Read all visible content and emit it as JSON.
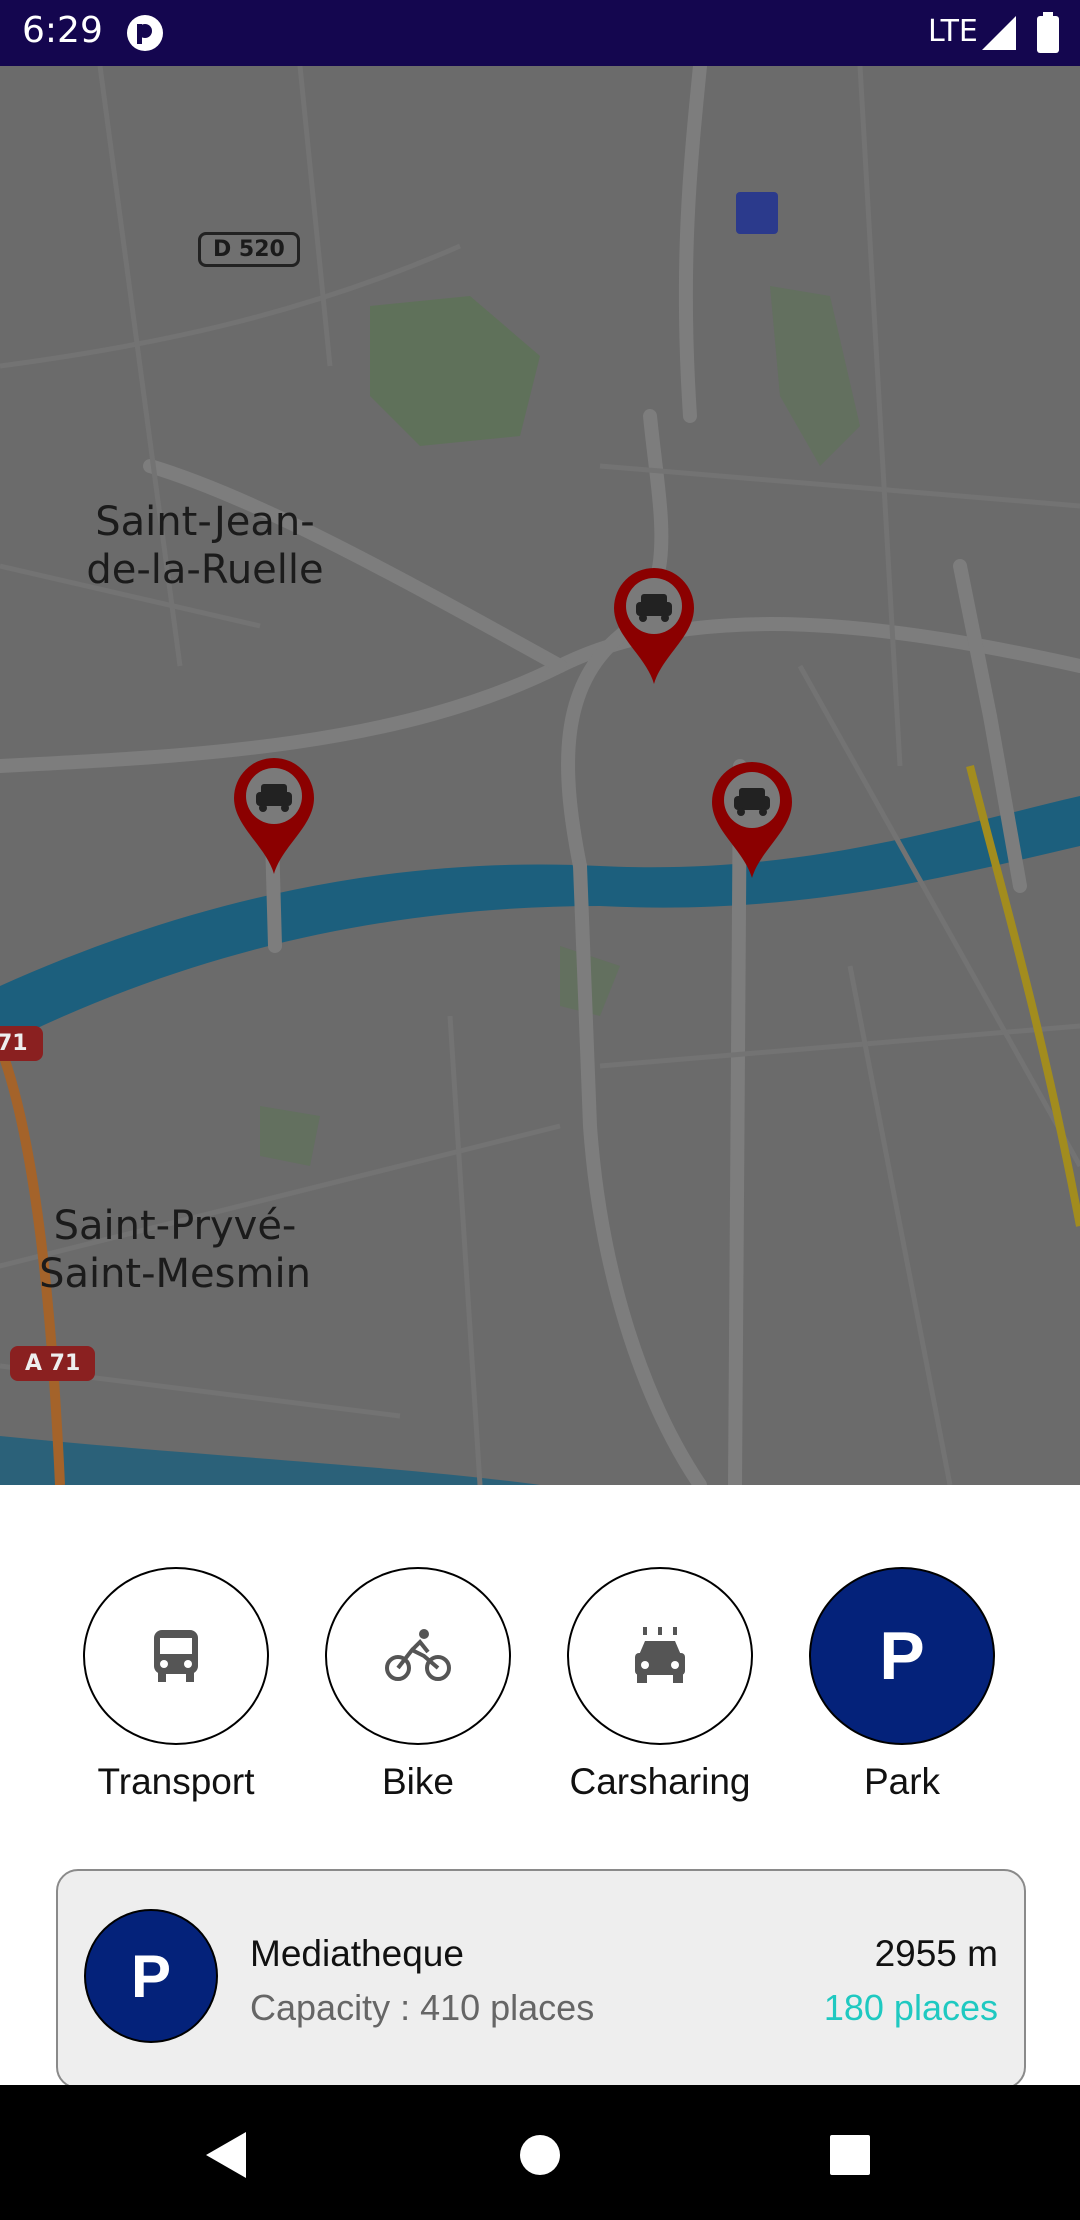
{
  "status_bar": {
    "time": "6:29",
    "network": "LTE",
    "background_color": "#14064f"
  },
  "map": {
    "labels": {
      "saint_jean_line1": "Saint-Jean-",
      "saint_jean_line2": "de-la-Ruelle",
      "saint_pryve_line1": "Saint-Pryvé-",
      "saint_pryve_line2": "Saint-Mesmin"
    },
    "road_shields": {
      "d520": "D 520",
      "a71": "A 71",
      "a71_partial": "71"
    },
    "markers": [
      {
        "name": "parking-marker",
        "icon": "car-icon"
      },
      {
        "name": "parking-marker",
        "icon": "car-icon"
      },
      {
        "name": "parking-marker",
        "icon": "car-icon"
      }
    ],
    "marker_color": "#8b0000",
    "river_color": "#1c5f7d"
  },
  "modes": [
    {
      "label": "Transport",
      "icon": "bus-icon",
      "active": false
    },
    {
      "label": "Bike",
      "icon": "bike-icon",
      "active": false
    },
    {
      "label": "Carsharing",
      "icon": "carsharing-icon",
      "active": false
    },
    {
      "label": "Park",
      "icon": "parking-icon",
      "active": true
    }
  ],
  "parking_card": {
    "icon_letter": "P",
    "name": "Mediatheque",
    "capacity": "Capacity : 410 places",
    "distance": "2955 m",
    "available": "180 places",
    "available_color": "#1fc9c1",
    "accent_color": "#04227a"
  },
  "nav_bar": {
    "back": "back-icon",
    "home": "home-icon",
    "recents": "recents-icon"
  }
}
